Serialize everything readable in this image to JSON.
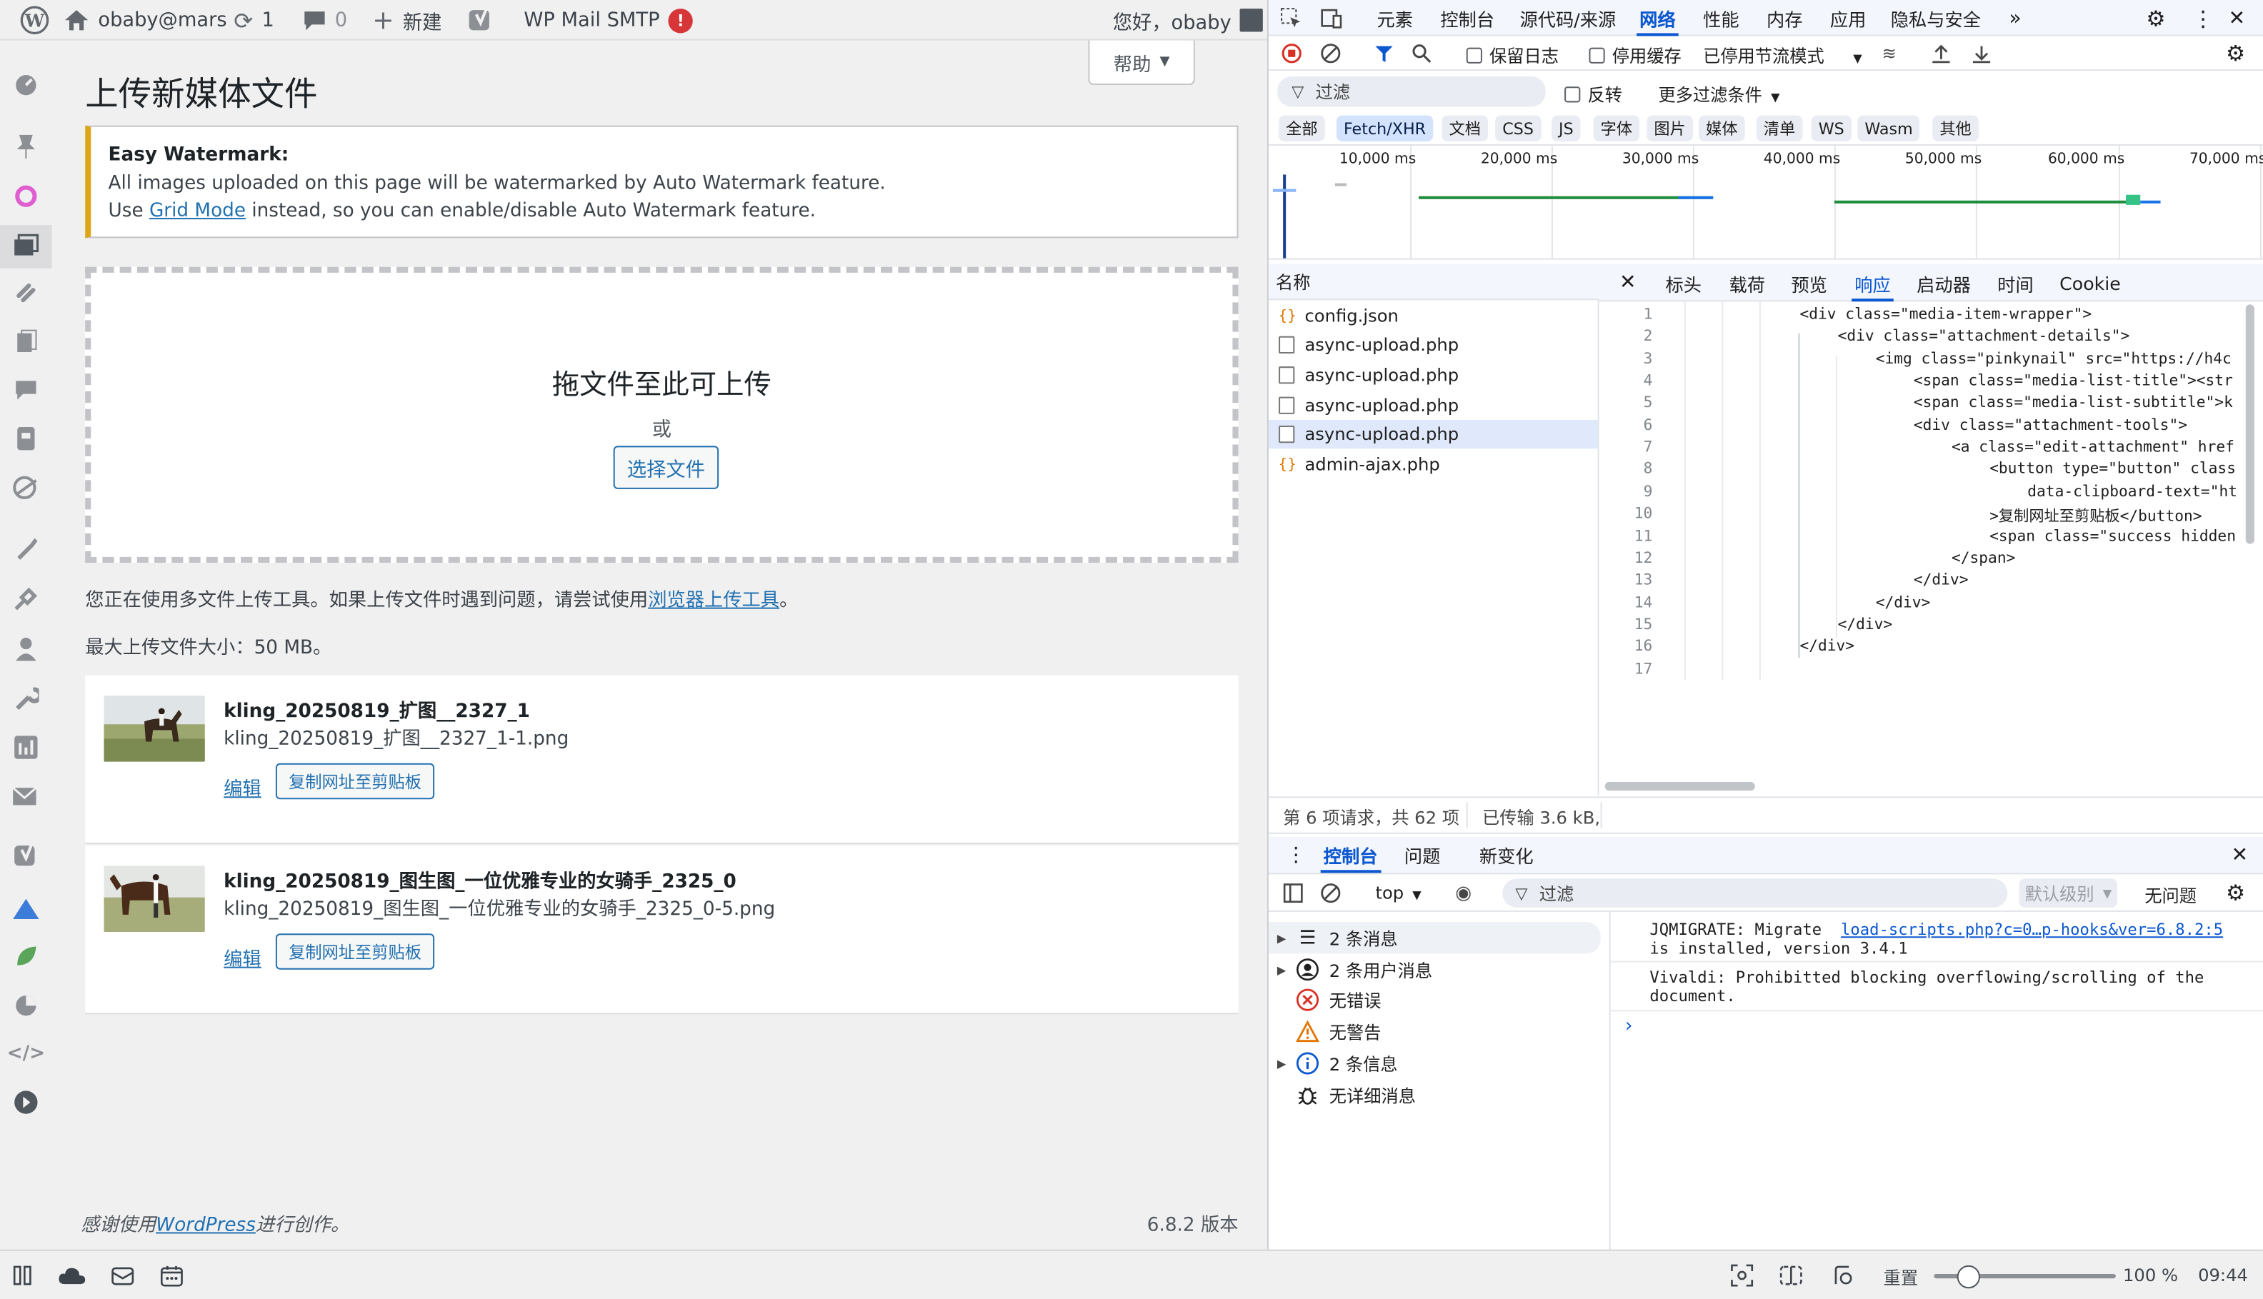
{
  "adminbar": {
    "site_name": "obaby@mars",
    "updates_count": "1",
    "comments_count": "0",
    "new_label": "新建",
    "smtp_label": "WP Mail SMTP",
    "smtp_badge": "!",
    "greeting": "您好，obaby"
  },
  "page": {
    "help_label": "帮助",
    "title": "上传新媒体文件",
    "notice_title": "Easy Watermark:",
    "notice_line1": "All images uploaded on this page will be watermarked by Auto Watermark feature.",
    "notice_line2_pre": "Use ",
    "notice_link": "Grid Mode",
    "notice_line2_post": " instead, so you can enable/disable Auto Watermark feature.",
    "drop_text": "拖文件至此可上传",
    "or_text": "或",
    "select_button": "选择文件",
    "multi_upload_pre": "您正在使用多文件上传工具。如果上传文件时遇到问题，请尝试使用",
    "browser_uploader": "浏览器上传工具",
    "multi_upload_post": "。",
    "max_size": "最大上传文件大小：50 MB。",
    "media_items": [
      {
        "title": "kling_20250819_扩图__2327_1",
        "filename": "kling_20250819_扩图__2327_1-1.png",
        "edit": "编辑",
        "copy": "复制网址至剪贴板"
      },
      {
        "title": "kling_20250819_图生图_一位优雅专业的女骑手_2325_0",
        "filename": "kling_20250819_图生图_一位优雅专业的女骑手_2325_0-5.png",
        "edit": "编辑",
        "copy": "复制网址至剪贴板"
      }
    ],
    "footer_pre": "感谢使用",
    "footer_link": "WordPress",
    "footer_post": "进行创作。",
    "version": "6.8.2 版本"
  },
  "devtools": {
    "tabs": [
      "元素",
      "控制台",
      "源代码/来源",
      "网络",
      "性能",
      "内存",
      "应用",
      "隐私与安全"
    ],
    "active_tab": "网络",
    "toolbar": {
      "preserve_log": "保留日志",
      "disable_cache": "停用缓存",
      "throttle": "已停用节流模式"
    },
    "filter": {
      "placeholder": "过滤",
      "invert": "反转",
      "more": "更多过滤条件"
    },
    "type_filters": [
      "全部",
      "Fetch/XHR",
      "文档",
      "CSS",
      "JS",
      "字体",
      "图片",
      "媒体",
      "清单",
      "WS",
      "Wasm",
      "其他"
    ],
    "active_type_filter": "Fetch/XHR",
    "timeline_labels": [
      "10,000 ms",
      "20,000 ms",
      "30,000 ms",
      "40,000 ms",
      "50,000 ms",
      "60,000 ms",
      "70,000 ms"
    ],
    "name_header": "名称",
    "requests": [
      {
        "name": "config.json",
        "type": "json"
      },
      {
        "name": "async-upload.php",
        "type": "doc"
      },
      {
        "name": "async-upload.php",
        "type": "doc"
      },
      {
        "name": "async-upload.php",
        "type": "doc"
      },
      {
        "name": "async-upload.php",
        "type": "doc",
        "selected": true
      },
      {
        "name": "admin-ajax.php",
        "type": "json"
      }
    ],
    "detail_tabs": [
      "标头",
      "载荷",
      "预览",
      "响应",
      "启动器",
      "时间",
      "Cookie"
    ],
    "active_detail_tab": "响应",
    "response_lines": [
      "<div class=\"media-item-wrapper\">",
      "<div class=\"attachment-details\">",
      "<img class=\"pinkynail\" src=\"https://h4c",
      "<span class=\"media-list-title\"><str",
      "<span class=\"media-list-subtitle\">k",
      "<div class=\"attachment-tools\">",
      "<a class=\"edit-attachment\" href",
      "<button type=\"button\" class",
      "data-clipboard-text=\"ht",
      ">复制网址至剪贴板</button>",
      "<span class=\"success hidden",
      "</span>",
      "</div>",
      "</div>",
      "</div>",
      "</div>",
      ""
    ],
    "summary_requests": "第 6 项请求，共 62 项",
    "summary_transferred": "已传输 3.6 kB,",
    "drawer_tabs": [
      "控制台",
      "问题",
      "新变化"
    ],
    "active_drawer_tab": "控制台",
    "console_context": "top",
    "console_filter": "过滤",
    "console_level": "默认级别",
    "console_issues": "无问题",
    "console_groups": [
      {
        "label": "2 条消息",
        "icon": "list-icon",
        "expand": true
      },
      {
        "label": "2 条用户消息",
        "icon": "user-icon",
        "expand": true
      },
      {
        "label": "无错误",
        "icon": "error-icon",
        "expand": false
      },
      {
        "label": "无警告",
        "icon": "warning-icon",
        "expand": false
      },
      {
        "label": "2 条信息",
        "icon": "info-icon",
        "expand": true
      },
      {
        "label": "无详细消息",
        "icon": "bug-icon",
        "expand": false
      }
    ],
    "console_messages": {
      "jqmigrate_line1": "JQMIGRATE: Migrate",
      "jqmigrate_link": "load-scripts.php?c=0…p-hooks&ver=6.8.2:5",
      "jqmigrate_line2": "is installed, version 3.4.1",
      "vivaldi_line1": "Vivaldi: Prohibitted blocking overflowing/scrolling of the",
      "vivaldi_line2": "document."
    }
  },
  "statusbar": {
    "reset": "重置",
    "zoom": "100 %",
    "time": "09:44"
  },
  "colors": {
    "wp_link": "#2271b1",
    "devtools_accent": "#0b57d0",
    "notice_border": "#dba617",
    "badge_red": "#d63638"
  }
}
